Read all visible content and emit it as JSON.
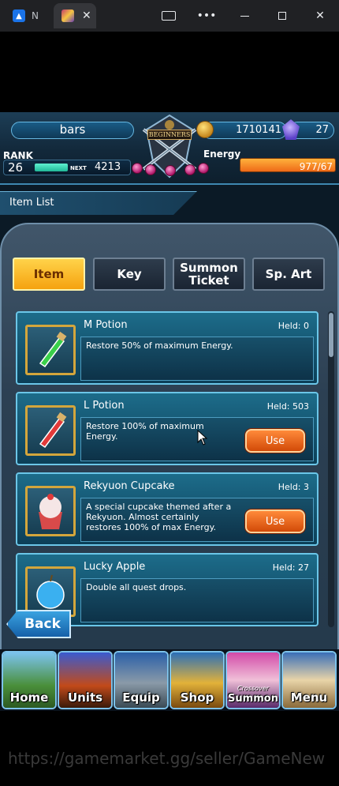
{
  "browser": {
    "tabs": [
      {
        "label": "N",
        "icon": "app-icon"
      },
      {
        "label": "",
        "icon": "game-icon"
      }
    ]
  },
  "hud": {
    "player_name": "bars",
    "money": "1710141",
    "gems": "27",
    "badge": "BEGINNERS",
    "rank_label": "RANK",
    "rank": "26",
    "next_label": "NEXT",
    "next_value": "4213",
    "energy_label": "Energy",
    "energy": "977/67"
  },
  "list_title": "Item List",
  "categories": [
    {
      "label": "Item",
      "active": true
    },
    {
      "label": "Key",
      "active": false
    },
    {
      "label": "Summon Ticket",
      "active": false
    },
    {
      "label": "Sp. Art",
      "active": false
    }
  ],
  "items": [
    {
      "name": "M Potion",
      "held": "Held: 0",
      "desc": "Restore 50% of maximum Energy.",
      "action": ""
    },
    {
      "name": "L Potion",
      "held": "Held: 503",
      "desc": "Restore 100% of maximum Energy.",
      "action": "Use"
    },
    {
      "name": "Rekyuon Cupcake",
      "held": "Held: 3",
      "desc": "A special cupcake themed after a Rekyuon. Almost certainly restores 100% of max Energy.",
      "action": "Use"
    },
    {
      "name": "Lucky Apple",
      "held": "Held: 27",
      "desc": "Double all quest drops.",
      "action": ""
    }
  ],
  "back_label": "Back",
  "nav": [
    {
      "label": "Home",
      "sub": ""
    },
    {
      "label": "Units",
      "sub": ""
    },
    {
      "label": "Equip",
      "sub": ""
    },
    {
      "label": "Shop",
      "sub": ""
    },
    {
      "label": "Summon",
      "sub": "Crossover"
    },
    {
      "label": "Menu",
      "sub": ""
    }
  ],
  "watermark": "https://gamemarket.gg/seller/GameNew"
}
